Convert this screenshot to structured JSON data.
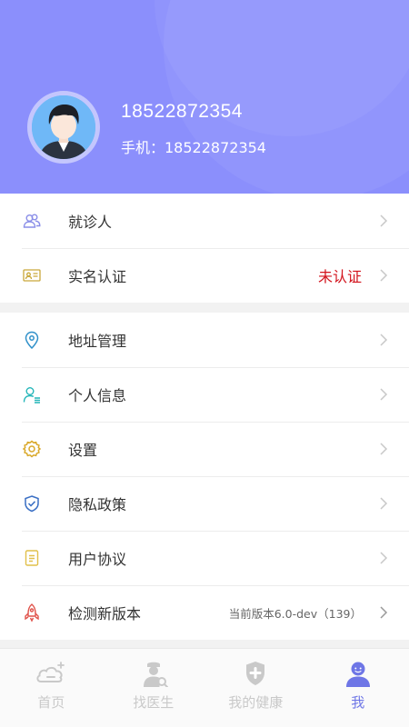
{
  "profile": {
    "display_name": "18522872354",
    "phone_line": "手机：18522872354"
  },
  "groups": [
    {
      "items": [
        {
          "label": "就诊人",
          "icon": "people-icon"
        },
        {
          "label": "实名认证",
          "icon": "id-card-icon",
          "value": "未认证",
          "value_color": "#d2121b"
        }
      ]
    },
    {
      "items": [
        {
          "label": "地址管理",
          "icon": "location-pin-icon"
        },
        {
          "label": "个人信息",
          "icon": "user-list-icon"
        },
        {
          "label": "设置",
          "icon": "gear-icon"
        },
        {
          "label": "隐私政策",
          "icon": "shield-check-icon"
        },
        {
          "label": "用户协议",
          "icon": "document-icon"
        },
        {
          "label": "检测新版本",
          "icon": "rocket-icon",
          "value": "当前版本6.0-dev（139）"
        }
      ]
    }
  ],
  "tabbar": {
    "tabs": [
      {
        "label": "首页",
        "icon": "home-cloud-icon",
        "active": false
      },
      {
        "label": "找医生",
        "icon": "doctor-search-icon",
        "active": false
      },
      {
        "label": "我的健康",
        "icon": "health-shield-icon",
        "active": false
      },
      {
        "label": "我",
        "icon": "me-avatar-icon",
        "active": true
      }
    ]
  },
  "colors": {
    "header_bg": "#8b8ffc",
    "accent": "#6e76e6",
    "warning_text": "#d2121b"
  }
}
